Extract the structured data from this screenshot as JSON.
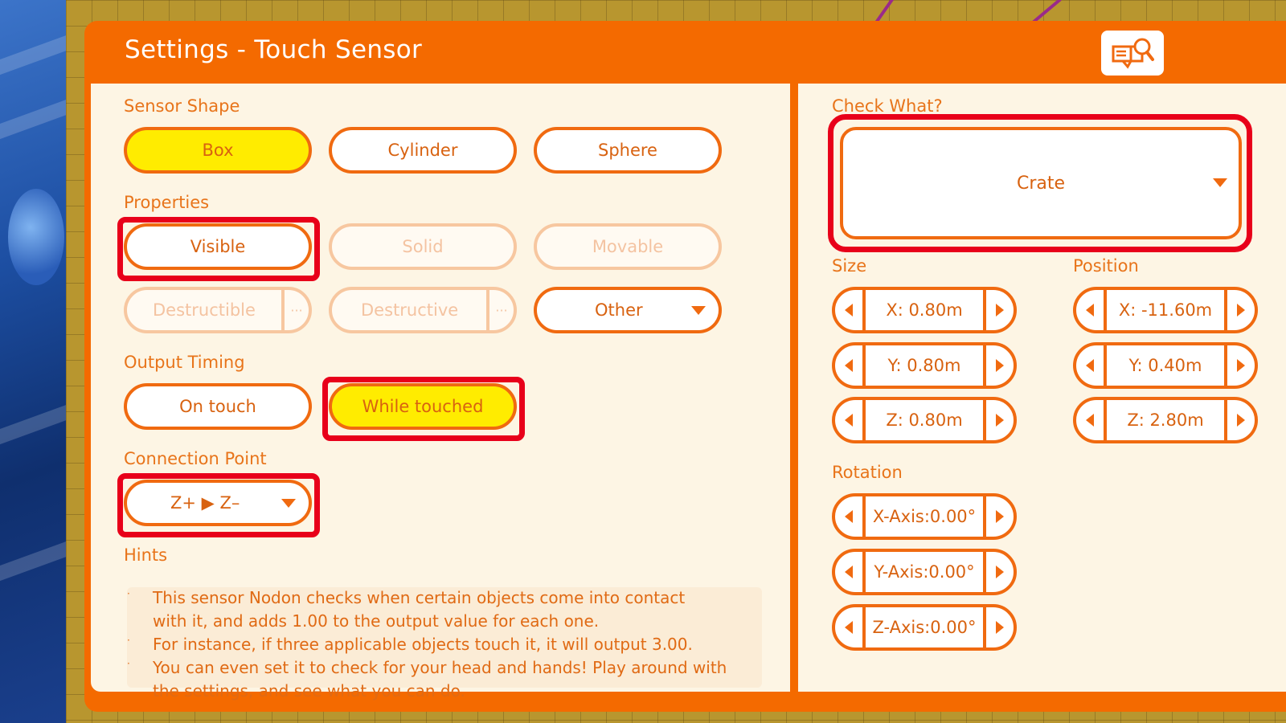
{
  "title": "Settings - Touch Sensor",
  "icons": {
    "help": "book-magnifier-icon",
    "caret": "caret-down-icon",
    "left_arrow": "arrow-left-icon",
    "right_arrow": "arrow-right-icon"
  },
  "colors": {
    "accent": "#f46a00",
    "panel_bg": "#fdf5e4",
    "selected": "#ffec00",
    "highlight": "#e8001a",
    "text": "#d86210"
  },
  "sensor_shape": {
    "label": "Sensor Shape",
    "options": [
      "Box",
      "Cylinder",
      "Sphere"
    ],
    "selected": "Box"
  },
  "properties": {
    "label": "Properties",
    "visible": "Visible",
    "solid": "Solid",
    "movable": "Movable",
    "destructible": "Destructible",
    "destructive": "Destructive",
    "more": "···",
    "other": "Other"
  },
  "output_timing": {
    "label": "Output Timing",
    "options": [
      "On touch",
      "While touched"
    ],
    "selected": "While touched"
  },
  "connection_point": {
    "label": "Connection Point",
    "value": "Z+ ▶ Z–"
  },
  "hints": {
    "label": "Hints",
    "lines": [
      "This sensor Nodon checks when certain objects come into contact",
      "with it, and adds 1.00 to the output value for each one.",
      "For instance, if three applicable objects touch it, it will output 3.00.",
      "You can even set it to check for your head and hands! Play around with",
      "the settings, and see what you can do."
    ]
  },
  "check_what": {
    "label": "Check What?",
    "value": "Crate"
  },
  "size": {
    "label": "Size",
    "x": "X: 0.80m",
    "y": "Y: 0.80m",
    "z": "Z: 0.80m"
  },
  "position": {
    "label": "Position",
    "x": "X: -11.60m",
    "y": "Y: 0.40m",
    "z": "Z: 2.80m"
  },
  "rotation": {
    "label": "Rotation",
    "x": "X-Axis:0.00°",
    "y": "Y-Axis:0.00°",
    "z": "Z-Axis:0.00°"
  }
}
